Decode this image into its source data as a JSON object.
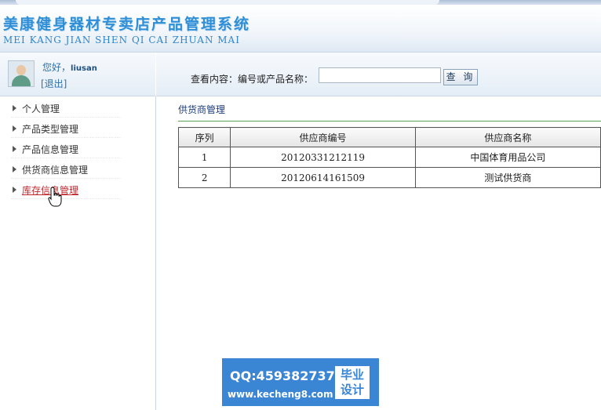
{
  "header": {
    "title": "美康健身器材专卖店产品管理系统",
    "subtitle": "MEI KANG JIAN SHEN QI CAI ZHUAN MAI"
  },
  "user": {
    "greeting": "您好，",
    "username": "liusan",
    "logout": "[退出]"
  },
  "search": {
    "label": "查看内容：编号或产品名称：",
    "value": "",
    "button": "查 询"
  },
  "sidebar": {
    "items": [
      {
        "label": "个人管理"
      },
      {
        "label": "产品类型管理"
      },
      {
        "label": "产品信息管理"
      },
      {
        "label": "供货商信息管理"
      },
      {
        "label": "库存信息管理"
      }
    ]
  },
  "main": {
    "section_title": "供货商管理",
    "table": {
      "headers": [
        "序列",
        "供应商编号",
        "供应商名称"
      ],
      "rows": [
        [
          "1",
          "20120331212119",
          "中国体育用品公司"
        ],
        [
          "2",
          "20120614161509",
          "测试供货商"
        ]
      ]
    }
  },
  "watermark": {
    "qq": "QQ:459382737",
    "url": "www.kecheng8.com",
    "badge_line1": "毕业",
    "badge_line2": "设计"
  },
  "colors": {
    "title": "#2f8fd6",
    "active_menu": "#c1272d",
    "rule": "#5aa05a",
    "watermark_bg": "#3a86d4"
  }
}
